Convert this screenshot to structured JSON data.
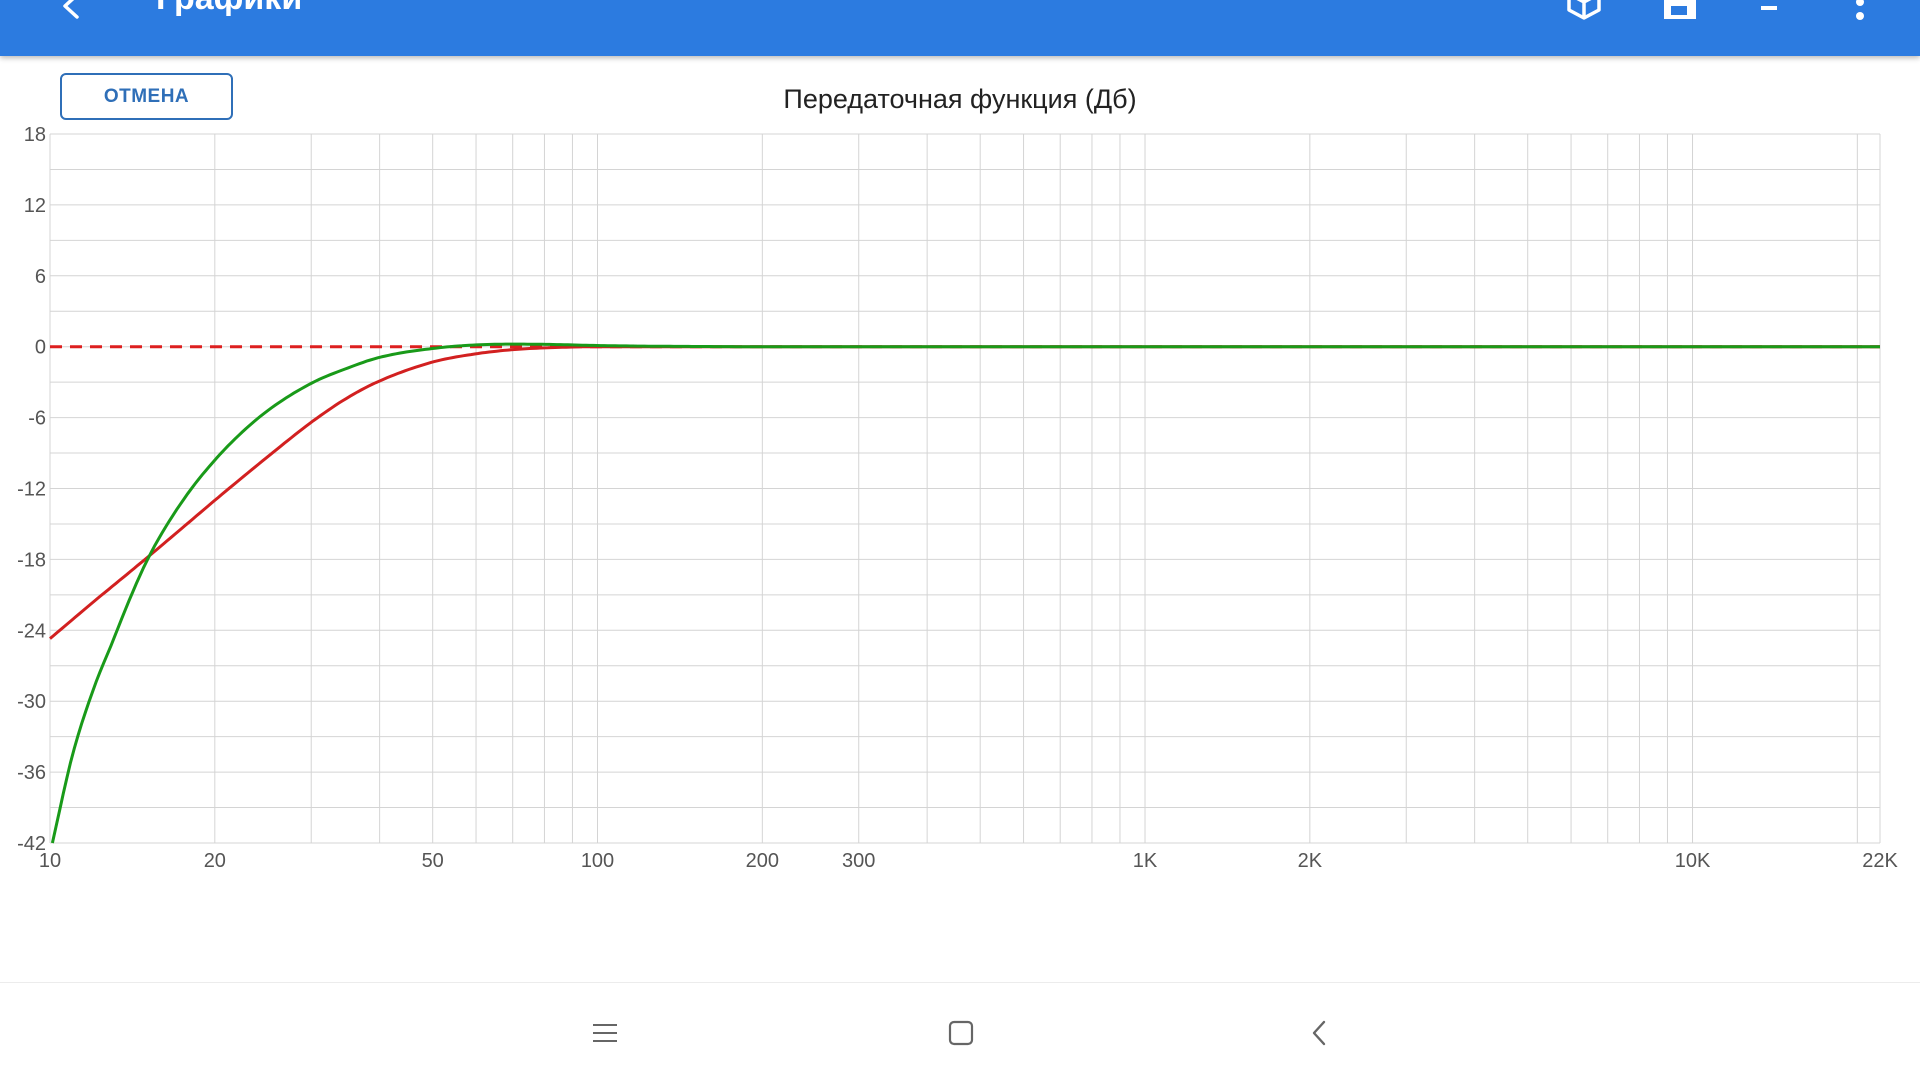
{
  "app_bar": {
    "title": "Графики",
    "background_color": "#2c7be0",
    "back_icon": "arrow-left-icon",
    "actions": [
      "cube-icon",
      "save-icon",
      "sort-list-icon",
      "more-vertical-icon"
    ]
  },
  "cancel_button": {
    "label": "ОТМЕНА"
  },
  "chart_data": {
    "type": "line",
    "title": "Передаточная функция (Дб)",
    "xscale": "log",
    "xlim": [
      10,
      22000
    ],
    "ylim": [
      -42,
      18
    ],
    "xticks": [
      {
        "value": 10,
        "label": "10"
      },
      {
        "value": 20,
        "label": "20"
      },
      {
        "value": 50,
        "label": "50"
      },
      {
        "value": 100,
        "label": "100"
      },
      {
        "value": 200,
        "label": "200"
      },
      {
        "value": 300,
        "label": "300"
      },
      {
        "value": 1000,
        "label": "1K"
      },
      {
        "value": 2000,
        "label": "2K"
      },
      {
        "value": 10000,
        "label": "10K"
      },
      {
        "value": 22000,
        "label": "22K"
      }
    ],
    "yticks": [
      18,
      12,
      6,
      0,
      -6,
      -12,
      -18,
      -24,
      -30,
      -36,
      -42
    ],
    "grid": true,
    "series": [
      {
        "color": "#dd1f1f",
        "dash": true,
        "x": [
          10,
          22000
        ],
        "y": [
          0,
          0
        ]
      },
      {
        "color": "#d22020",
        "dash": false,
        "x": [
          10,
          12,
          15,
          18,
          20,
          25,
          30,
          35,
          40,
          50,
          60,
          70,
          80,
          100,
          150,
          200,
          1000,
          22000
        ],
        "y": [
          -24.7,
          -21.6,
          -17.9,
          -14.8,
          -13,
          -9.3,
          -6.4,
          -4.3,
          -2.9,
          -1.3,
          -0.6,
          -0.25,
          -0.1,
          0,
          0,
          0,
          0,
          0
        ]
      },
      {
        "color": "#199a19",
        "dash": false,
        "x": [
          10.1,
          11,
          12,
          13,
          14,
          15,
          16,
          18,
          20,
          22,
          25,
          30,
          35,
          40,
          50,
          60,
          70,
          80,
          90,
          100,
          120,
          150,
          200,
          300,
          1000,
          22000
        ],
        "y": [
          -42,
          -34.5,
          -29,
          -25,
          -21.3,
          -18.2,
          -15.8,
          -12.2,
          -9.6,
          -7.6,
          -5.4,
          -3.1,
          -1.8,
          -0.9,
          -0.15,
          0.15,
          0.22,
          0.2,
          0.15,
          0.1,
          0.05,
          0.02,
          0,
          0,
          0,
          0
        ]
      }
    ]
  },
  "nav_bar": {
    "items": [
      "menu-lines-icon",
      "home-square-icon",
      "back-chevron-icon"
    ]
  }
}
